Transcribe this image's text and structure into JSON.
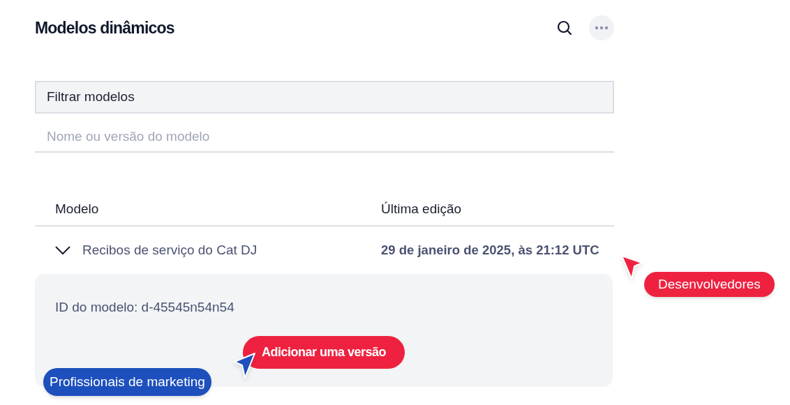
{
  "header": {
    "title": "Modelos dinâmicos"
  },
  "filter": {
    "label": "Filtrar modelos",
    "placeholder": "Nome ou versão do modelo"
  },
  "table": {
    "columns": [
      "Modelo",
      "Última edição"
    ],
    "rows": [
      {
        "name": "Recibos de serviço do Cat DJ",
        "edited": "29 de janeiro de 2025, às 21:12 UTC",
        "expanded": true,
        "detail": "ID do modelo: d-45545n54n54",
        "action": "Adicionar uma versão"
      }
    ]
  },
  "cursors": [
    {
      "label": "Desenvolvedores",
      "color": "#ee2240"
    },
    {
      "label": "Profissionais de marketing",
      "color": "#1d4fbd"
    }
  ]
}
